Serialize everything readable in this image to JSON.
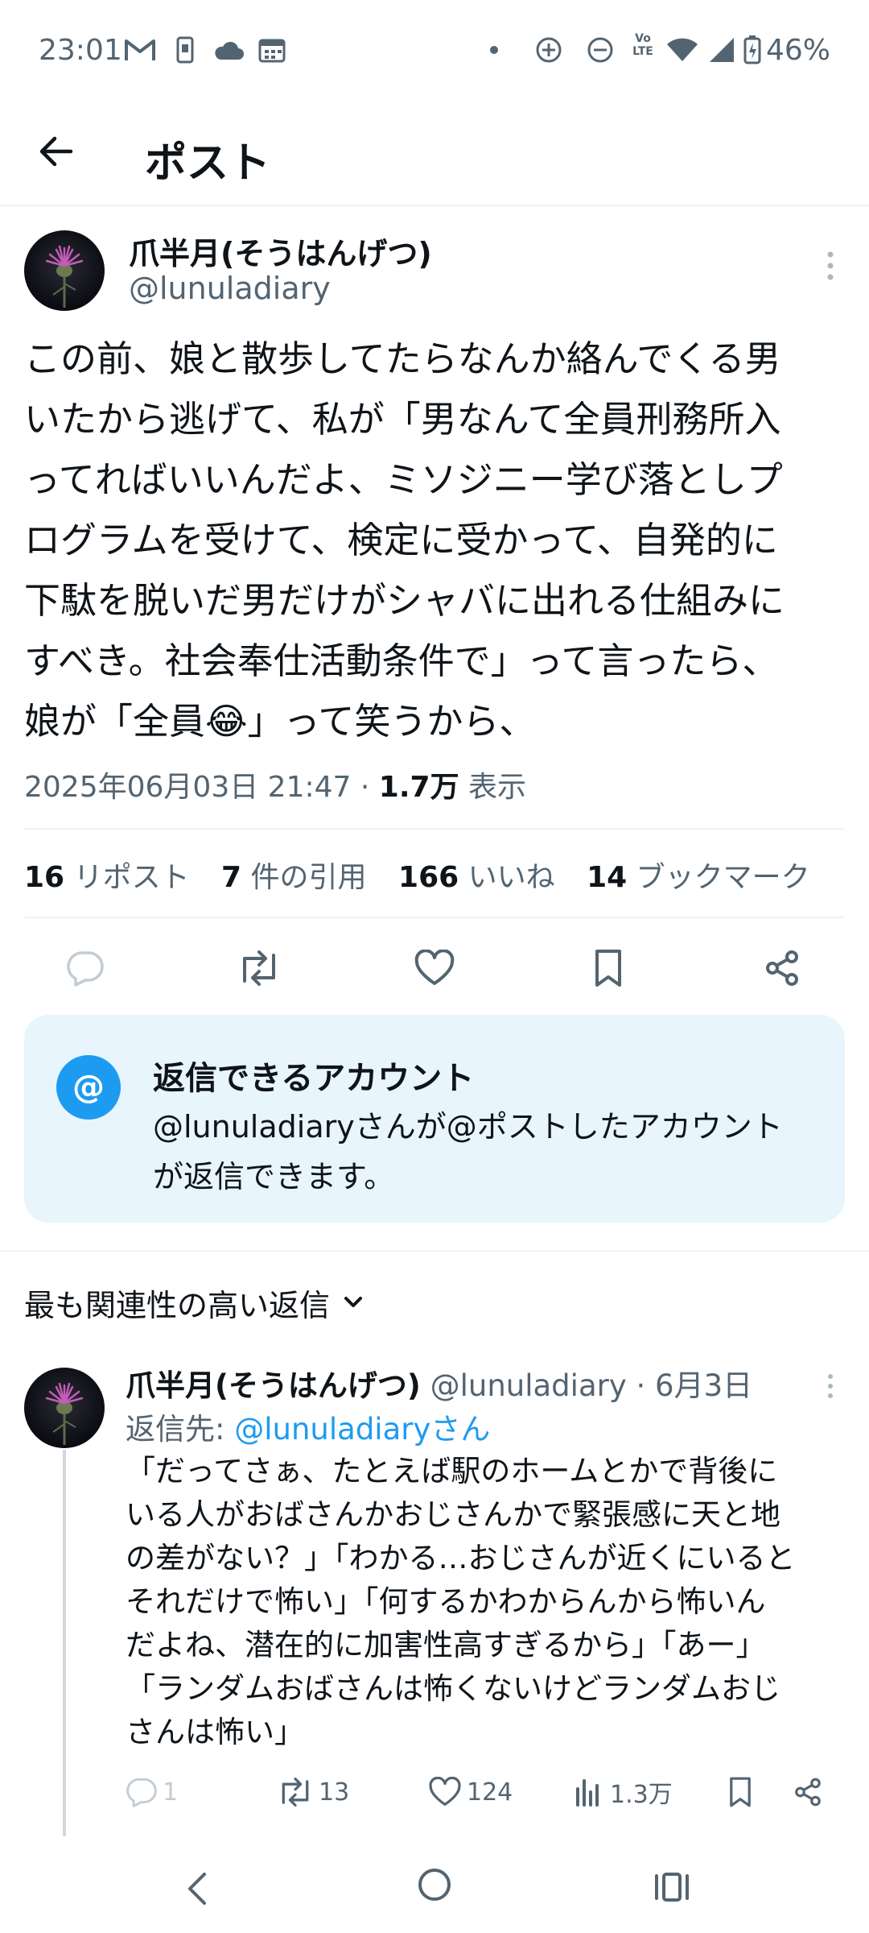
{
  "status_bar": {
    "time": "23:01",
    "volte": "Vo LTE",
    "battery_percent": "46%"
  },
  "header": {
    "title": "ポスト"
  },
  "post": {
    "author_name": "爪半月(そうはんげつ)",
    "author_handle": "@lunuladiary",
    "text_lines": [
      "この前、娘と散歩してたらなんか絡んでくる男",
      "いたから逃げて、私が「男なんて全員刑務所入",
      "ってればいいんだよ、ミソジニー学び落としプ",
      "ログラムを受けて、検定に受かって、自発的に",
      "下駄を脱いだ男だけがシャバに出れる仕組みに",
      "すべき。社会奉仕活動条件で」って言ったら、",
      "娘が「全員😂」って笑うから、"
    ],
    "timestamp": "2025年06月03日 21:47",
    "separator": "·",
    "views": "1.7万",
    "views_label": "表示"
  },
  "stats": {
    "reposts": "16",
    "reposts_label": "リポスト",
    "quotes": "7",
    "quotes_label": "件の引用",
    "likes": "166",
    "likes_label": "いいね",
    "bookmarks": "14",
    "bookmarks_label": "ブックマーク"
  },
  "reply_restriction": {
    "title": "返信できるアカウント",
    "line1": "@lunuladiaryさんが@ポストしたアカウント",
    "line2": "が返信できます。"
  },
  "replies_sort": {
    "label": "最も関連性の高い返信"
  },
  "reply": {
    "author_name": "爪半月(そうはんげつ)",
    "author_handle": "@lunuladiary",
    "date": "· 6月3日",
    "reply_to_label": "返信先:",
    "reply_to_handle": "@lunuladiaryさん",
    "text_lines": [
      "「だってさぁ、たとえば駅のホームとかで背後に",
      "いる人がおばさんかおじさんかで緊張感に天と地",
      "の差がない？」「わかる…おじさんが近くにいると",
      "それだけで怖い」「何するかわからんから怖いん",
      "だよね、潜在的に加害性高すぎるから」「あー」",
      "「ランダムおばさんは怖くないけどランダムおじ",
      "さんは怖い」"
    ],
    "replies_count": "1",
    "reposts_count": "13",
    "likes_count": "124",
    "views_count": "1.3万"
  },
  "colors": {
    "accent": "#1d9bf0",
    "muted": "#536471",
    "text": "#0f1419",
    "divider": "#eff3f4",
    "info_bg": "#e8f5fd"
  }
}
